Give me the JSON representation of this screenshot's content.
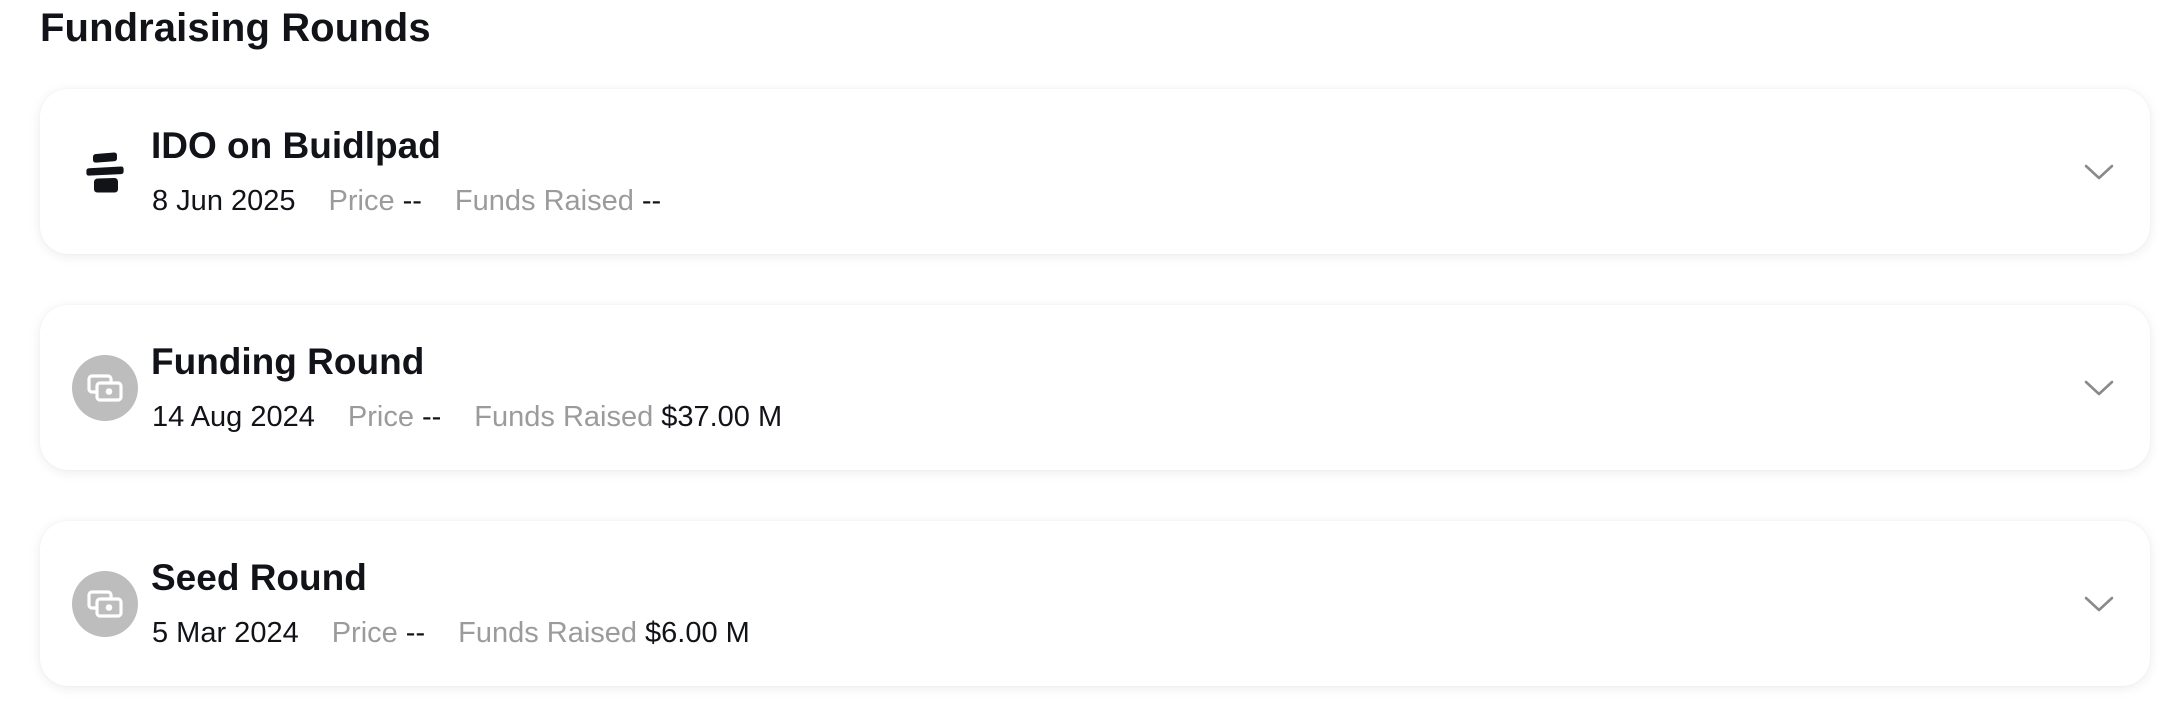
{
  "section": {
    "title": "Fundraising Rounds"
  },
  "rounds": [
    {
      "title": "IDO on Buidlpad",
      "date": "8 Jun 2025",
      "price_label": "Price",
      "price_value": "--",
      "funds_label": "Funds Raised",
      "funds_value": "--",
      "icon": "buidlpad-logo-icon"
    },
    {
      "title": "Funding Round",
      "date": "14 Aug 2024",
      "price_label": "Price",
      "price_value": "--",
      "funds_label": "Funds Raised",
      "funds_value": "$37.00 M",
      "icon": "money-icon"
    },
    {
      "title": "Seed Round",
      "date": "5 Mar 2024",
      "price_label": "Price",
      "price_value": "--",
      "funds_label": "Funds Raised",
      "funds_value": "$6.00 M",
      "icon": "money-icon"
    }
  ],
  "colors": {
    "text_primary": "#111319",
    "text_muted": "#9b9b9b",
    "icon_circle": "#bdbdbd",
    "chevron": "#8a8a8a"
  }
}
